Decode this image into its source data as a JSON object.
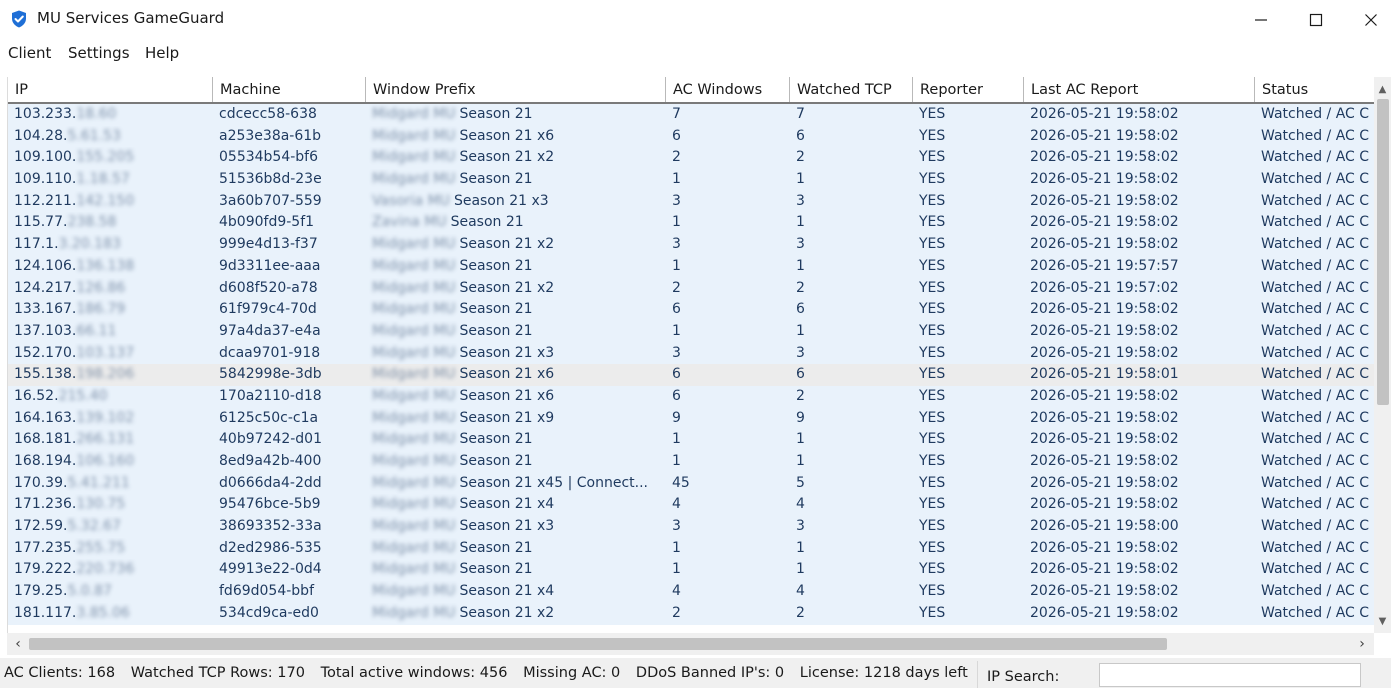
{
  "window": {
    "title": "MU Services GameGuard",
    "icon": "shield-check-icon",
    "controls": [
      "minimize-icon",
      "maximize-icon",
      "close-icon"
    ]
  },
  "menu": [
    "Client",
    "Settings",
    "Help"
  ],
  "table": {
    "columns": [
      "IP",
      "Machine",
      "Window Prefix",
      "AC Windows",
      "Watched TCP",
      "Reporter",
      "Last AC Report",
      "Status"
    ],
    "rows": [
      {
        "ip": "103.233.",
        "ip_masked": "18.60",
        "machine": "cdcecc58-638",
        "prefix_masked": "Midgard MU",
        "prefix": "Season 21",
        "ac": "7",
        "tcp": "7",
        "reporter": "YES",
        "last": "2026-05-21 19:58:02",
        "status": "Watched / AC C"
      },
      {
        "ip": "104.28.",
        "ip_masked": "5.61.53",
        "machine": "a253e38a-61b",
        "prefix_masked": "Midgard MU",
        "prefix": "Season 21 x6",
        "ac": "6",
        "tcp": "6",
        "reporter": "YES",
        "last": "2026-05-21 19:58:02",
        "status": "Watched / AC C"
      },
      {
        "ip": "109.100.",
        "ip_masked": "155.205",
        "machine": "05534b54-bf6",
        "prefix_masked": "Midgard MU",
        "prefix": "Season 21 x2",
        "ac": "2",
        "tcp": "2",
        "reporter": "YES",
        "last": "2026-05-21 19:58:02",
        "status": "Watched / AC C"
      },
      {
        "ip": "109.110.",
        "ip_masked": "1.18.57",
        "machine": "51536b8d-23e",
        "prefix_masked": "Midgard MU",
        "prefix": "Season 21",
        "ac": "1",
        "tcp": "1",
        "reporter": "YES",
        "last": "2026-05-21 19:58:02",
        "status": "Watched / AC C"
      },
      {
        "ip": "112.211.",
        "ip_masked": "142.150",
        "machine": "3a60b707-559",
        "prefix_masked": "Vasoria MU",
        "prefix": "Season 21 x3",
        "ac": "3",
        "tcp": "3",
        "reporter": "YES",
        "last": "2026-05-21 19:58:02",
        "status": "Watched / AC C"
      },
      {
        "ip": "115.77.",
        "ip_masked": "238.58",
        "machine": "4b090fd9-5f1",
        "prefix_masked": "Zavina MU",
        "prefix": "Season 21",
        "ac": "1",
        "tcp": "1",
        "reporter": "YES",
        "last": "2026-05-21 19:58:02",
        "status": "Watched / AC C"
      },
      {
        "ip": "117.1.",
        "ip_masked": "3.20.183",
        "machine": "999e4d13-f37",
        "prefix_masked": "Midgard MU",
        "prefix": "Season 21 x2",
        "ac": "3",
        "tcp": "3",
        "reporter": "YES",
        "last": "2026-05-21 19:58:02",
        "status": "Watched / AC C"
      },
      {
        "ip": "124.106.",
        "ip_masked": "136.138",
        "machine": "9d3311ee-aaa",
        "prefix_masked": "Midgard MU",
        "prefix": "Season 21",
        "ac": "1",
        "tcp": "1",
        "reporter": "YES",
        "last": "2026-05-21 19:57:57",
        "status": "Watched / AC C"
      },
      {
        "ip": "124.217.",
        "ip_masked": "126.86",
        "machine": "d608f520-a78",
        "prefix_masked": "Midgard MU",
        "prefix": "Season 21 x2",
        "ac": "2",
        "tcp": "2",
        "reporter": "YES",
        "last": "2026-05-21 19:57:02",
        "status": "Watched / AC C"
      },
      {
        "ip": "133.167.",
        "ip_masked": "186.79",
        "machine": "61f979c4-70d",
        "prefix_masked": "Midgard MU",
        "prefix": "Season 21",
        "ac": "6",
        "tcp": "6",
        "reporter": "YES",
        "last": "2026-05-21 19:58:02",
        "status": "Watched / AC C"
      },
      {
        "ip": "137.103.",
        "ip_masked": "66.11",
        "machine": "97a4da37-e4a",
        "prefix_masked": "Midgard MU",
        "prefix": "Season 21",
        "ac": "1",
        "tcp": "1",
        "reporter": "YES",
        "last": "2026-05-21 19:58:02",
        "status": "Watched / AC C"
      },
      {
        "ip": "152.170.",
        "ip_masked": "103.137",
        "machine": "dcaa9701-918",
        "prefix_masked": "Midgard MU",
        "prefix": "Season 21 x3",
        "ac": "3",
        "tcp": "3",
        "reporter": "YES",
        "last": "2026-05-21 19:58:02",
        "status": "Watched / AC C"
      },
      {
        "ip": "155.138.",
        "ip_masked": "198.206",
        "machine": "5842998e-3db",
        "prefix_masked": "Midgard MU",
        "prefix": "Season 21 x6",
        "ac": "6",
        "tcp": "6",
        "reporter": "YES",
        "last": "2026-05-21 19:58:01",
        "status": "Watched / AC C",
        "selected": true
      },
      {
        "ip": "16.52.",
        "ip_masked": "215.40",
        "machine": "170a2110-d18",
        "prefix_masked": "Midgard MU",
        "prefix": "Season 21 x6",
        "ac": "6",
        "tcp": "2",
        "reporter": "YES",
        "last": "2026-05-21 19:58:02",
        "status": "Watched / AC C"
      },
      {
        "ip": "164.163.",
        "ip_masked": "139.102",
        "machine": "6125c50c-c1a",
        "prefix_masked": "Midgard MU",
        "prefix": "Season 21 x9",
        "ac": "9",
        "tcp": "9",
        "reporter": "YES",
        "last": "2026-05-21 19:58:02",
        "status": "Watched / AC C"
      },
      {
        "ip": "168.181.",
        "ip_masked": "266.131",
        "machine": "40b97242-d01",
        "prefix_masked": "Midgard MU",
        "prefix": "Season 21",
        "ac": "1",
        "tcp": "1",
        "reporter": "YES",
        "last": "2026-05-21 19:58:02",
        "status": "Watched / AC C"
      },
      {
        "ip": "168.194.",
        "ip_masked": "106.160",
        "machine": "8ed9a42b-400",
        "prefix_masked": "Midgard MU",
        "prefix": "Season 21",
        "ac": "1",
        "tcp": "1",
        "reporter": "YES",
        "last": "2026-05-21 19:58:02",
        "status": "Watched / AC C"
      },
      {
        "ip": "170.39.",
        "ip_masked": "5.41.211",
        "machine": "d0666da4-2dd",
        "prefix_masked": "Midgard MU",
        "prefix": "Season 21 x45 | Connect...",
        "ac": "45",
        "tcp": "5",
        "reporter": "YES",
        "last": "2026-05-21 19:58:02",
        "status": "Watched / AC C"
      },
      {
        "ip": "171.236.",
        "ip_masked": "130.75",
        "machine": "95476bce-5b9",
        "prefix_masked": "Midgard MU",
        "prefix": "Season 21 x4",
        "ac": "4",
        "tcp": "4",
        "reporter": "YES",
        "last": "2026-05-21 19:58:02",
        "status": "Watched / AC C"
      },
      {
        "ip": "172.59.",
        "ip_masked": "5.32.67",
        "machine": "38693352-33a",
        "prefix_masked": "Midgard MU",
        "prefix": "Season 21 x3",
        "ac": "3",
        "tcp": "3",
        "reporter": "YES",
        "last": "2026-05-21 19:58:00",
        "status": "Watched / AC C"
      },
      {
        "ip": "177.235.",
        "ip_masked": "255.75",
        "machine": "d2ed2986-535",
        "prefix_masked": "Midgard MU",
        "prefix": "Season 21",
        "ac": "1",
        "tcp": "1",
        "reporter": "YES",
        "last": "2026-05-21 19:58:02",
        "status": "Watched / AC C"
      },
      {
        "ip": "179.222.",
        "ip_masked": "220.736",
        "machine": "49913e22-0d4",
        "prefix_masked": "Midgard MU",
        "prefix": "Season 21",
        "ac": "1",
        "tcp": "1",
        "reporter": "YES",
        "last": "2026-05-21 19:58:02",
        "status": "Watched / AC C"
      },
      {
        "ip": "179.25.",
        "ip_masked": "5.0.87",
        "machine": "fd69d054-bbf",
        "prefix_masked": "Midgard MU",
        "prefix": "Season 21 x4",
        "ac": "4",
        "tcp": "4",
        "reporter": "YES",
        "last": "2026-05-21 19:58:02",
        "status": "Watched / AC C"
      },
      {
        "ip": "181.117.",
        "ip_masked": "3.85.06",
        "machine": "534cd9ca-ed0",
        "prefix_masked": "Midgard MU",
        "prefix": "Season 21 x2",
        "ac": "2",
        "tcp": "2",
        "reporter": "YES",
        "last": "2026-05-21 19:58:02",
        "status": "Watched / AC C"
      }
    ]
  },
  "status": {
    "ac_clients": "AC Clients: 168",
    "watched_tcp": "Watched TCP Rows: 170",
    "total_windows": "Total active windows: 456",
    "missing_ac": "Missing AC: 0",
    "ddos": "DDoS Banned IP's: 0",
    "license": "License: 1218 days left"
  },
  "search": {
    "label": "IP Search:",
    "value": ""
  }
}
